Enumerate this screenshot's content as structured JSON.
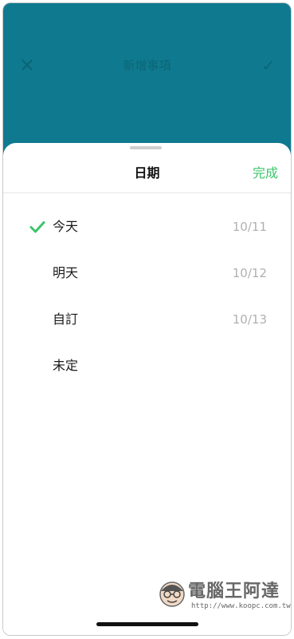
{
  "background_screen": {
    "title": "新增事項",
    "close_icon": "close-icon",
    "confirm_icon": "check-icon",
    "color": "#0f7a8f"
  },
  "sheet": {
    "title": "日期",
    "done_label": "完成",
    "accent_color": "#3cc46a"
  },
  "options": [
    {
      "label": "今天",
      "date": "10/11",
      "selected": true
    },
    {
      "label": "明天",
      "date": "10/12",
      "selected": false
    },
    {
      "label": "自訂",
      "date": "10/13",
      "selected": false
    },
    {
      "label": "未定",
      "date": "",
      "selected": false
    }
  ],
  "watermark": {
    "text": "電腦王阿達",
    "url": "http://www.koopc.com.tw"
  }
}
